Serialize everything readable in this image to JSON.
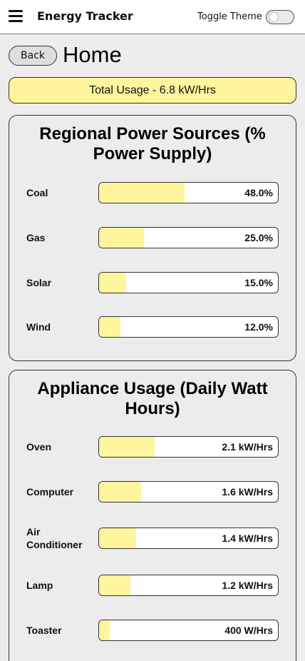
{
  "header": {
    "title": "Energy Tracker",
    "theme_toggle_label": "Toggle Theme",
    "theme_toggle_on": false
  },
  "nav": {
    "back_label": "Back",
    "page_title": "Home"
  },
  "total_usage": "Total Usage - 6.8 kW/Hrs",
  "regional_sources": {
    "title": "Regional Power Sources (% Power Supply)",
    "items": [
      {
        "label": "Coal",
        "value_text": "48.0%",
        "fraction": 0.48
      },
      {
        "label": "Gas",
        "value_text": "25.0%",
        "fraction": 0.25
      },
      {
        "label": "Solar",
        "value_text": "15.0%",
        "fraction": 0.15
      },
      {
        "label": "Wind",
        "value_text": "12.0%",
        "fraction": 0.12
      }
    ]
  },
  "appliance_usage": {
    "title": "Appliance Usage (Daily Watt Hours)",
    "items": [
      {
        "label": "Oven",
        "value_text": "2.1 kW/Hrs",
        "fraction": 0.31
      },
      {
        "label": "Computer",
        "value_text": "1.6 kW/Hrs",
        "fraction": 0.235
      },
      {
        "label": "Air Conditioner",
        "value_text": "1.4 kW/Hrs",
        "fraction": 0.206
      },
      {
        "label": "Lamp",
        "value_text": "1.2 kW/Hrs",
        "fraction": 0.176
      },
      {
        "label": "Toaster",
        "value_text": "400 W/Hrs",
        "fraction": 0.059
      }
    ]
  },
  "colors": {
    "accent": "#fff59d",
    "background": "#ededed",
    "border": "#333333"
  }
}
